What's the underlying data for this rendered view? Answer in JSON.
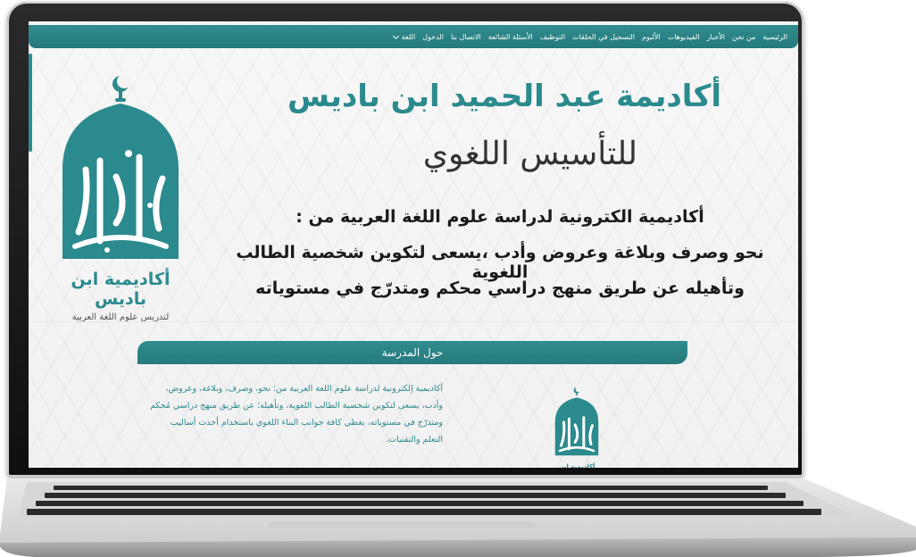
{
  "nav": {
    "items": [
      "الرئيسية",
      "من نحن",
      "الأخبار",
      "الفيديوهات",
      "الألبوم",
      "التسجيل في الحلقات",
      "التوظيف",
      "الأسئلة الشائعة",
      "الاتصال بنا",
      "الدخول",
      "اللغة"
    ]
  },
  "hero": {
    "title": "أكاديمة عبد الحميد ابن باديس",
    "subtitle": "للتأسيس اللغوي",
    "line1": "أكاديمية الكترونية لدراسة علوم اللغة العربية من :",
    "line2": "نحو وصرف  وبلاغة وعروض وأدب  ،يسعى لتكوين شخصية الطالب اللغوية",
    "line3": "وتأهيله عن طريق  منهج دراسي محكم ومتدرّج في مستوياته"
  },
  "logo": {
    "name": "أكاديمية ابن باديس",
    "tagline": "لتدريس علوم اللغة العربية"
  },
  "about": {
    "title": "حول المدرسة",
    "text": "أكاديمية إلكترونية لدراسة علوم اللغة العربية من: نحو، وصرف، وبلاغة، وعروض، وأدب، يسعى لتكوين شخصية الطالب اللغوية، وتأهيله؛ عن طريق منهج دراسي مُحكم ومتدرّج في مستوياته، يغطي كافة جوانب البناء اللغوي باستخدام أحدث أساليب التعلم والتقنيات."
  },
  "colors": {
    "accent": "#2b8a8d",
    "navbar": "#2f8c8e"
  }
}
